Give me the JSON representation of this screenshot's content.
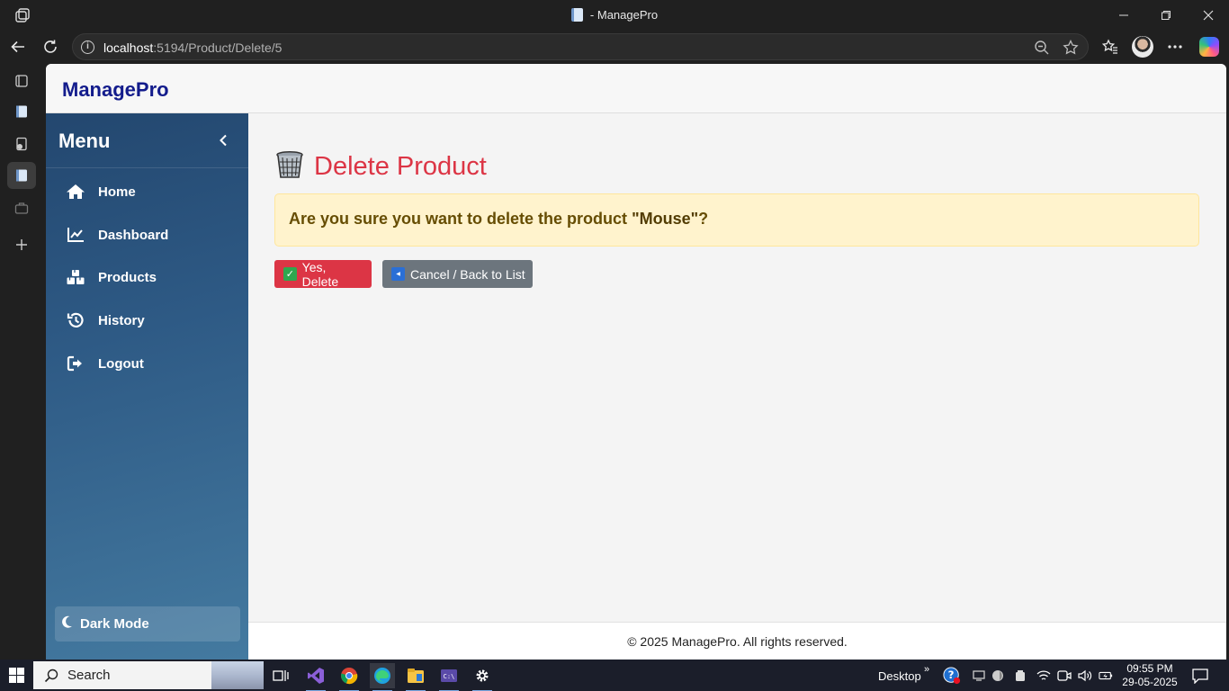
{
  "browser": {
    "window_title": "- ManagePro",
    "url_host": "localhost",
    "url_path": ":5194/Product/Delete/5"
  },
  "app": {
    "brand": "ManagePro",
    "sidebar": {
      "title": "Menu",
      "items": [
        {
          "label": "Home",
          "icon": "home-icon"
        },
        {
          "label": "Dashboard",
          "icon": "chart-line-icon"
        },
        {
          "label": "Products",
          "icon": "boxes-icon"
        },
        {
          "label": "History",
          "icon": "history-icon"
        },
        {
          "label": "Logout",
          "icon": "logout-icon"
        }
      ],
      "dark_mode_label": "Dark Mode"
    },
    "page": {
      "title": "Delete Product",
      "confirm_prefix": "Are you sure you want to delete the product ",
      "product_name": "\"Mouse\"",
      "confirm_suffix": "?",
      "delete_button": "Yes, Delete",
      "cancel_button": "Cancel / Back to List"
    },
    "footer": "© 2025 ManagePro. All rights reserved."
  },
  "taskbar": {
    "search_label": "Search",
    "desktop_label": "Desktop",
    "time": "09:55 PM",
    "date": "29-05-2025"
  },
  "colors": {
    "danger": "#dc3545",
    "secondary": "#6c757d",
    "brand": "#131c8c",
    "alert_bg": "#fff3cd"
  }
}
